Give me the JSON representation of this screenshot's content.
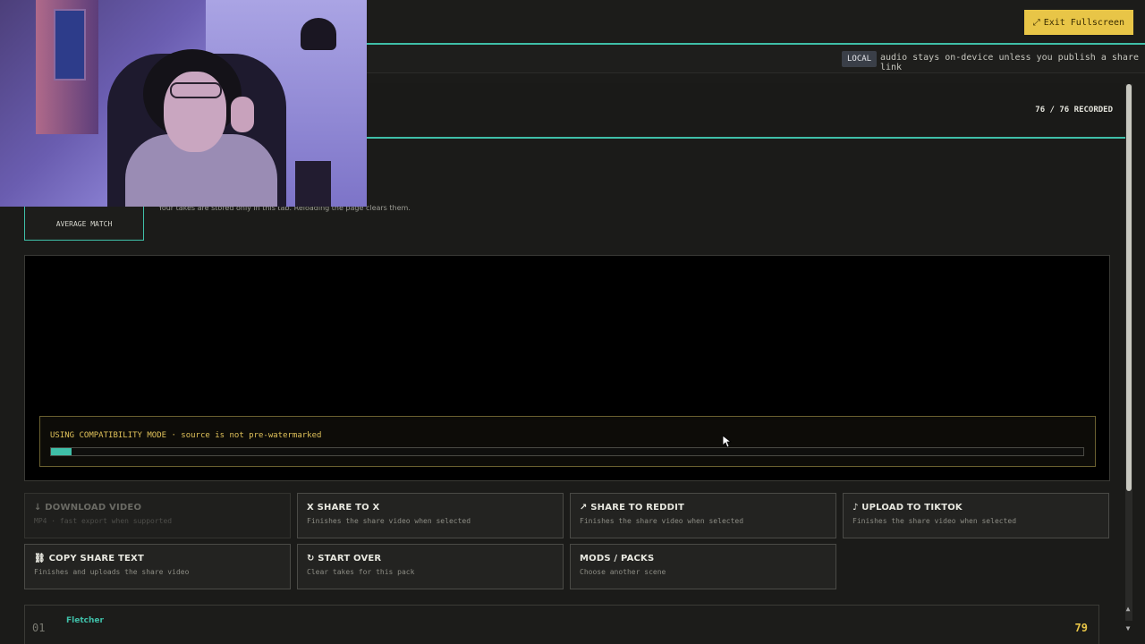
{
  "topbar": {
    "exit_label": "Exit Fullscreen",
    "exit_icon": "expand-arrows-icon"
  },
  "privacy": {
    "badge": "LOCAL",
    "text": "audio stays on-device unless you publish a share link"
  },
  "header": {
    "recorded": "76 / 76 RECORDED"
  },
  "stats": {
    "average_label": "AVERAGE MATCH",
    "info": "Your takes are stored only in this tab. Reloading the page clears them."
  },
  "video": {
    "compat_text": "USING COMPATIBILITY MODE · source is not pre-watermarked",
    "progress": 0.02
  },
  "actions": [
    {
      "icon": "↓",
      "label": "DOWNLOAD VIDEO",
      "sub": "MP4 · fast export when supported",
      "disabled": true
    },
    {
      "icon": "X",
      "label": "SHARE TO X",
      "sub": "Finishes the share video when selected"
    },
    {
      "icon": "↗",
      "label": "SHARE TO REDDIT",
      "sub": "Finishes the share video when selected"
    },
    {
      "icon": "♪",
      "label": "UPLOAD TO TIKTOK",
      "sub": "Finishes the share video when selected"
    },
    {
      "icon": "⛓",
      "label": "COPY SHARE TEXT",
      "sub": "Finishes and uploads the share video"
    },
    {
      "icon": "↻",
      "label": "START OVER",
      "sub": "Clear takes for this pack"
    },
    {
      "icon": "",
      "label": "MODS / PACKS",
      "sub": "Choose another scene"
    }
  ],
  "takes": [
    {
      "num": "01",
      "name": "Fletcher",
      "score": "79"
    }
  ]
}
